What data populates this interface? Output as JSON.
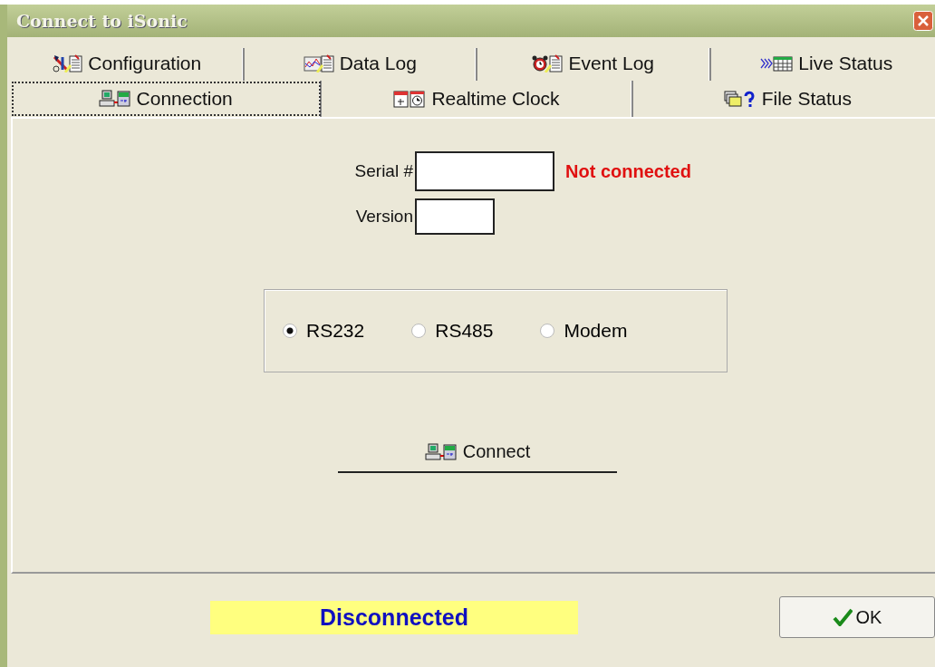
{
  "window": {
    "title": "Connect to iSonic"
  },
  "tab_rows": [
    [
      {
        "label": "Configuration",
        "selected": false
      },
      {
        "label": "Data Log",
        "selected": false
      },
      {
        "label": "Event Log",
        "selected": false
      },
      {
        "label": "Live Status",
        "selected": false
      }
    ],
    [
      {
        "label": "Connection",
        "selected": true
      },
      {
        "label": "Realtime Clock",
        "selected": false
      },
      {
        "label": "File Status",
        "selected": false
      }
    ]
  ],
  "form": {
    "serial_label": "Serial #",
    "version_label": "Version",
    "connection_status": "Not connected"
  },
  "ports": [
    {
      "label": "RS232",
      "selected": true
    },
    {
      "label": "RS485",
      "selected": false
    },
    {
      "label": "Modem",
      "selected": false
    }
  ],
  "connect_button": "Connect",
  "status_bar": {
    "status": "Disconnected",
    "ok_button": "OK"
  }
}
